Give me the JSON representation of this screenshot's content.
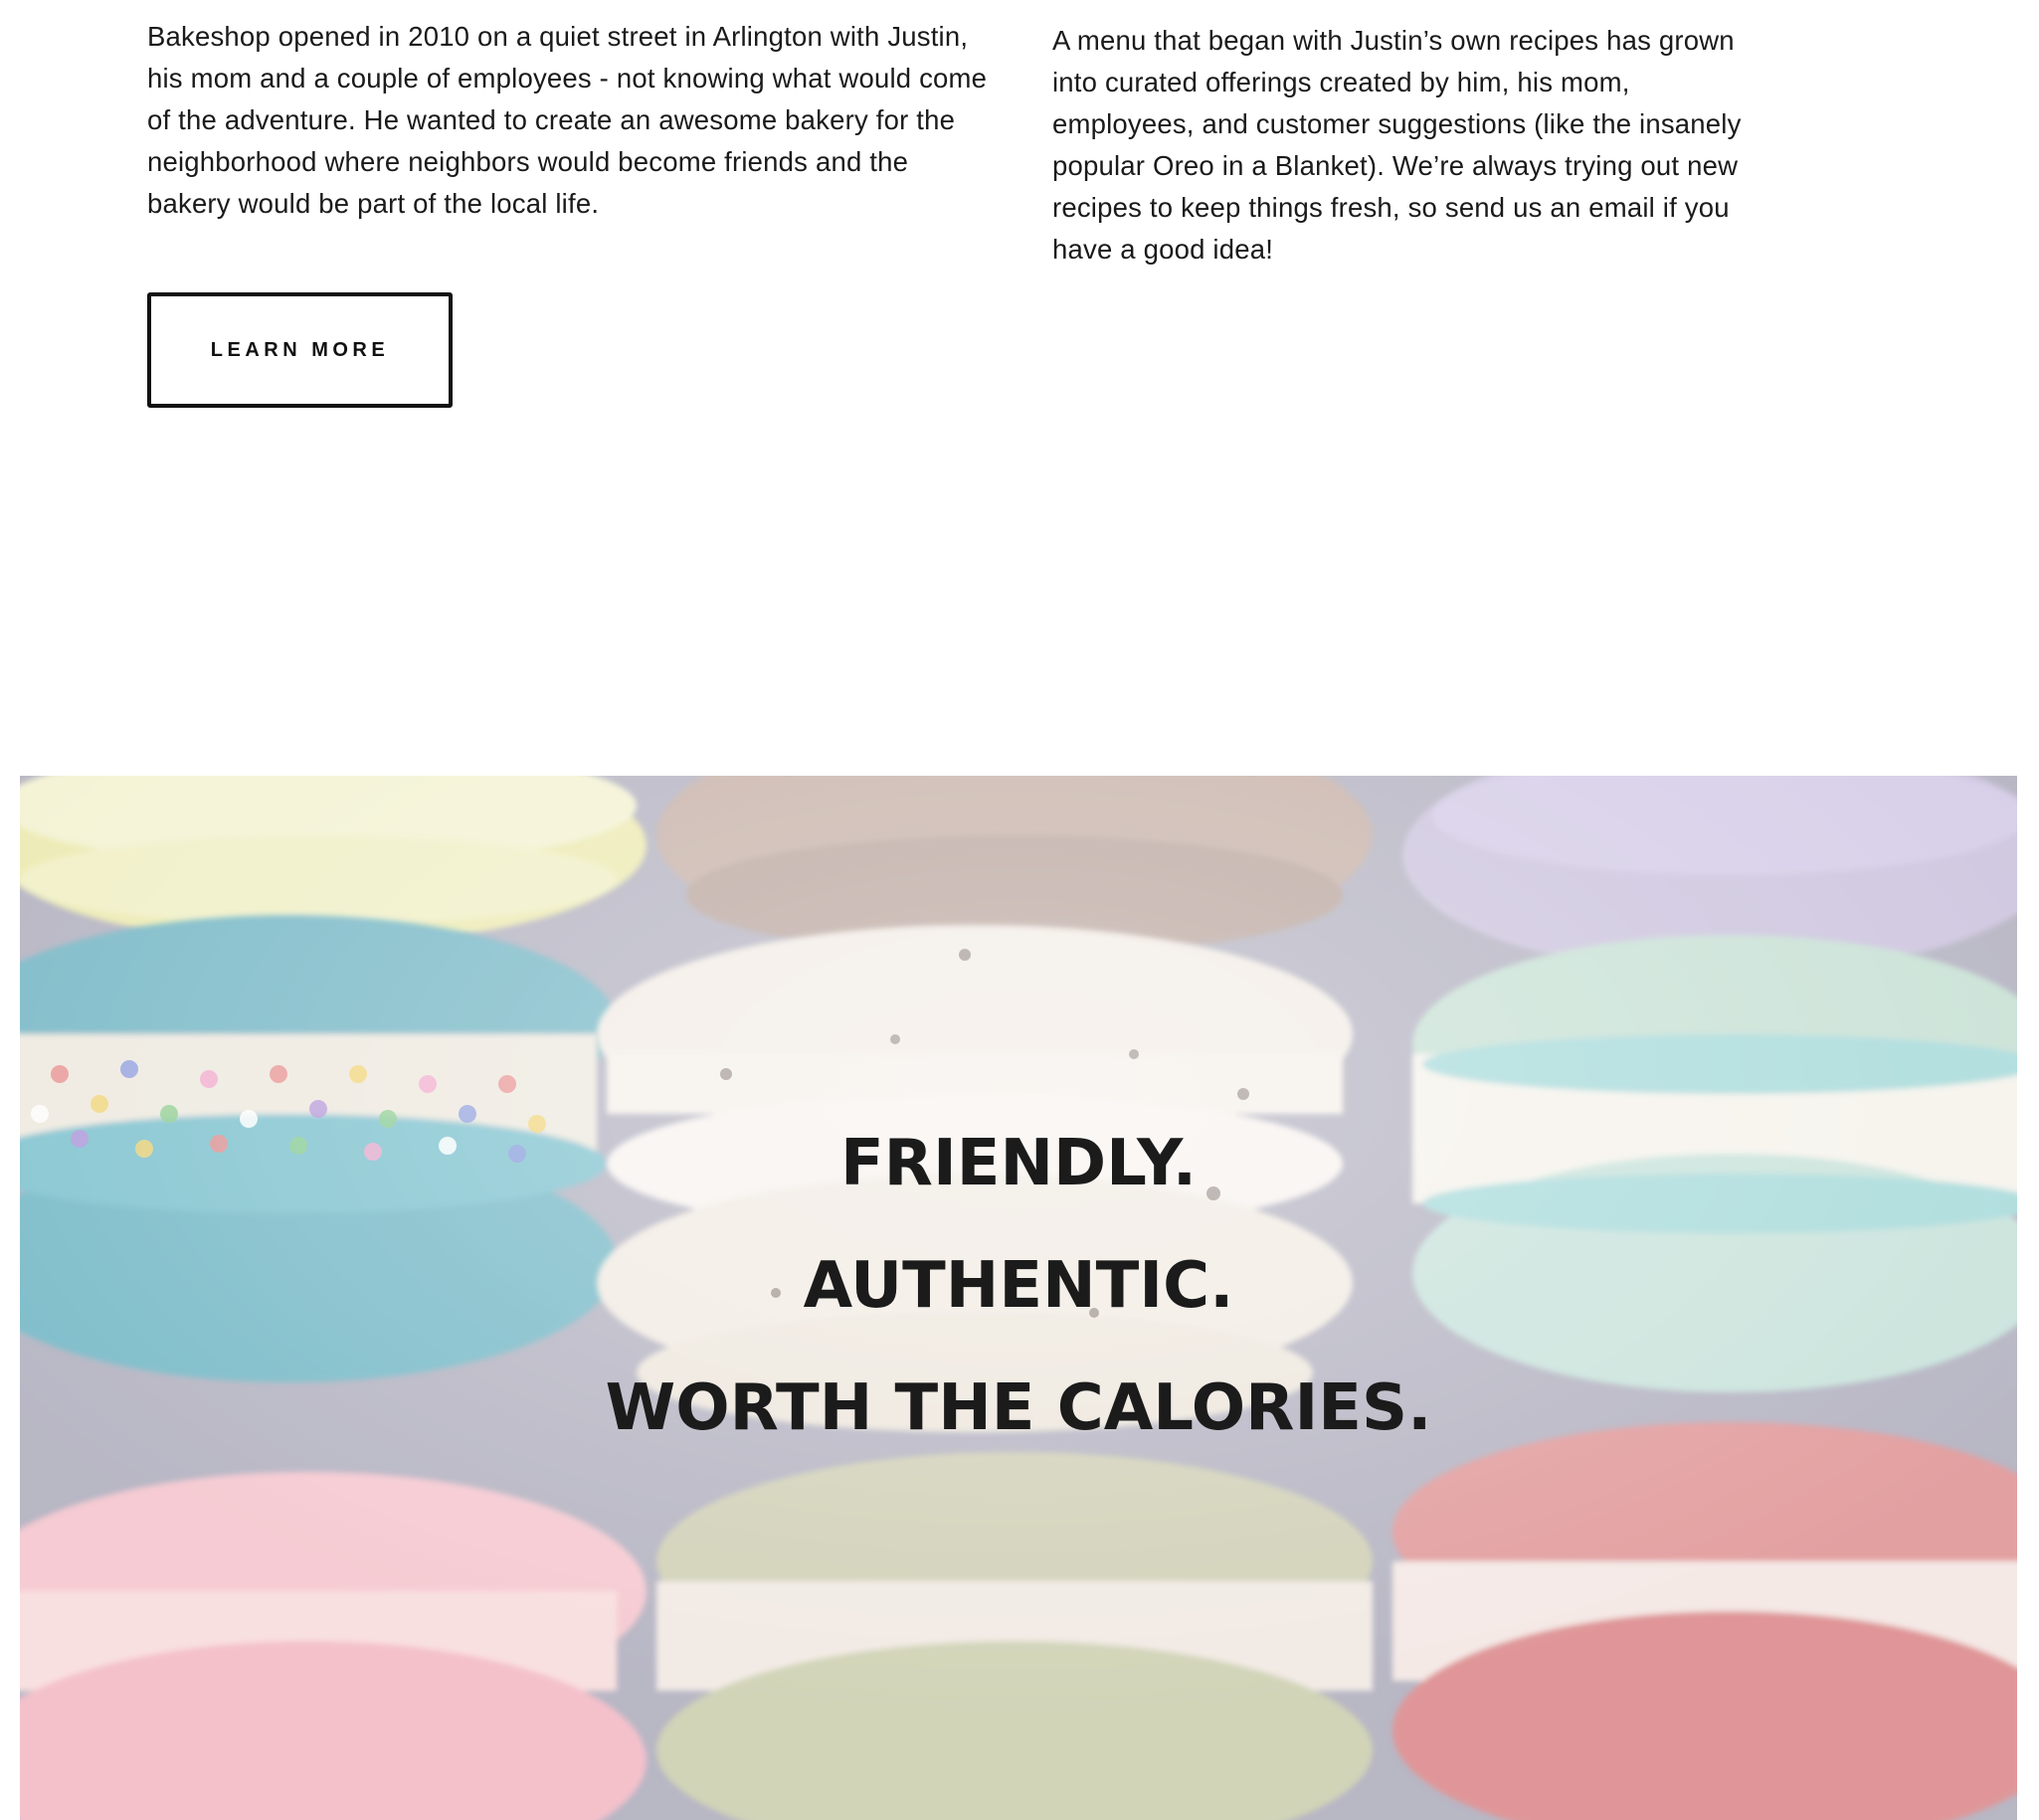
{
  "about": {
    "story_text": "Bakeshop opened in 2010 on a quiet street in Arlington with Justin, his mom and a couple of employees - not knowing what would come of the adventure.  He wanted to create an awesome bakery for the neighborhood where neighbors would become friends and the bakery would be part of the local life.",
    "menu_text": "A menu that began with Justin’s own recipes has grown into curated offerings created by him, his mom, employees, and customer suggestions (like the insanely popular Oreo in a Blanket). We’re always trying out new recipes to keep things fresh, so send us an email if you have a good idea!",
    "learn_more_label": "LEARN MORE"
  },
  "hero": {
    "line1": "FRIENDLY.",
    "line2": "AUTHENTIC.",
    "line3": "WORTH THE CALORIES."
  }
}
